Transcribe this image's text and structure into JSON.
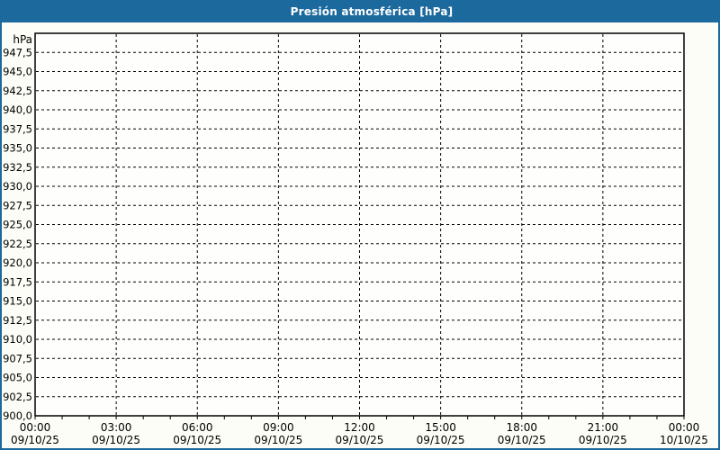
{
  "window": {
    "title": "Presión atmosférica [hPa]"
  },
  "colors": {
    "title_bar_bg": "#1c699d",
    "title_text": "#ffffff",
    "frame_border": "#1c699d",
    "page_bg": "#fdfdf7",
    "plot_bg": "#fefefc",
    "grid_line": "#000000",
    "axis_line": "#000000",
    "label_text": "#000000"
  },
  "chart_data": {
    "type": "line",
    "title": "Presión atmosférica [hPa]",
    "series": [],
    "grid": "dashed",
    "legend": "none",
    "y_axis": {
      "unit_label": "hPa",
      "min": 900,
      "max": 950,
      "grid_step": 2.5,
      "ticks": [
        {
          "value": 947.5,
          "label": "947,5"
        },
        {
          "value": 945.0,
          "label": "945,0"
        },
        {
          "value": 942.5,
          "label": "942,5"
        },
        {
          "value": 940.0,
          "label": "940,0"
        },
        {
          "value": 937.5,
          "label": "937,5"
        },
        {
          "value": 935.0,
          "label": "935,0"
        },
        {
          "value": 932.5,
          "label": "932,5"
        },
        {
          "value": 930.0,
          "label": "930,0"
        },
        {
          "value": 927.5,
          "label": "927,5"
        },
        {
          "value": 925.0,
          "label": "925,0"
        },
        {
          "value": 922.5,
          "label": "922,5"
        },
        {
          "value": 920.0,
          "label": "920,0"
        },
        {
          "value": 917.5,
          "label": "917,5"
        },
        {
          "value": 915.0,
          "label": "915,0"
        },
        {
          "value": 912.5,
          "label": "912,5"
        },
        {
          "value": 910.0,
          "label": "910,0"
        },
        {
          "value": 907.5,
          "label": "907,5"
        },
        {
          "value": 905.0,
          "label": "905,0"
        },
        {
          "value": 902.5,
          "label": "902,5"
        },
        {
          "value": 900.0,
          "label": "900,0"
        }
      ]
    },
    "x_axis": {
      "hours_span": 24,
      "major_step_hours": 3,
      "minor_tick_hours": 1,
      "ticks": [
        {
          "hour": 0,
          "time": "00:00",
          "date": "09/10/25"
        },
        {
          "hour": 3,
          "time": "03:00",
          "date": "09/10/25"
        },
        {
          "hour": 6,
          "time": "06:00",
          "date": "09/10/25"
        },
        {
          "hour": 9,
          "time": "09:00",
          "date": "09/10/25"
        },
        {
          "hour": 12,
          "time": "12:00",
          "date": "09/10/25"
        },
        {
          "hour": 15,
          "time": "15:00",
          "date": "09/10/25"
        },
        {
          "hour": 18,
          "time": "18:00",
          "date": "09/10/25"
        },
        {
          "hour": 21,
          "time": "21:00",
          "date": "09/10/25"
        },
        {
          "hour": 24,
          "time": "00:00",
          "date": "10/10/25"
        }
      ]
    }
  }
}
